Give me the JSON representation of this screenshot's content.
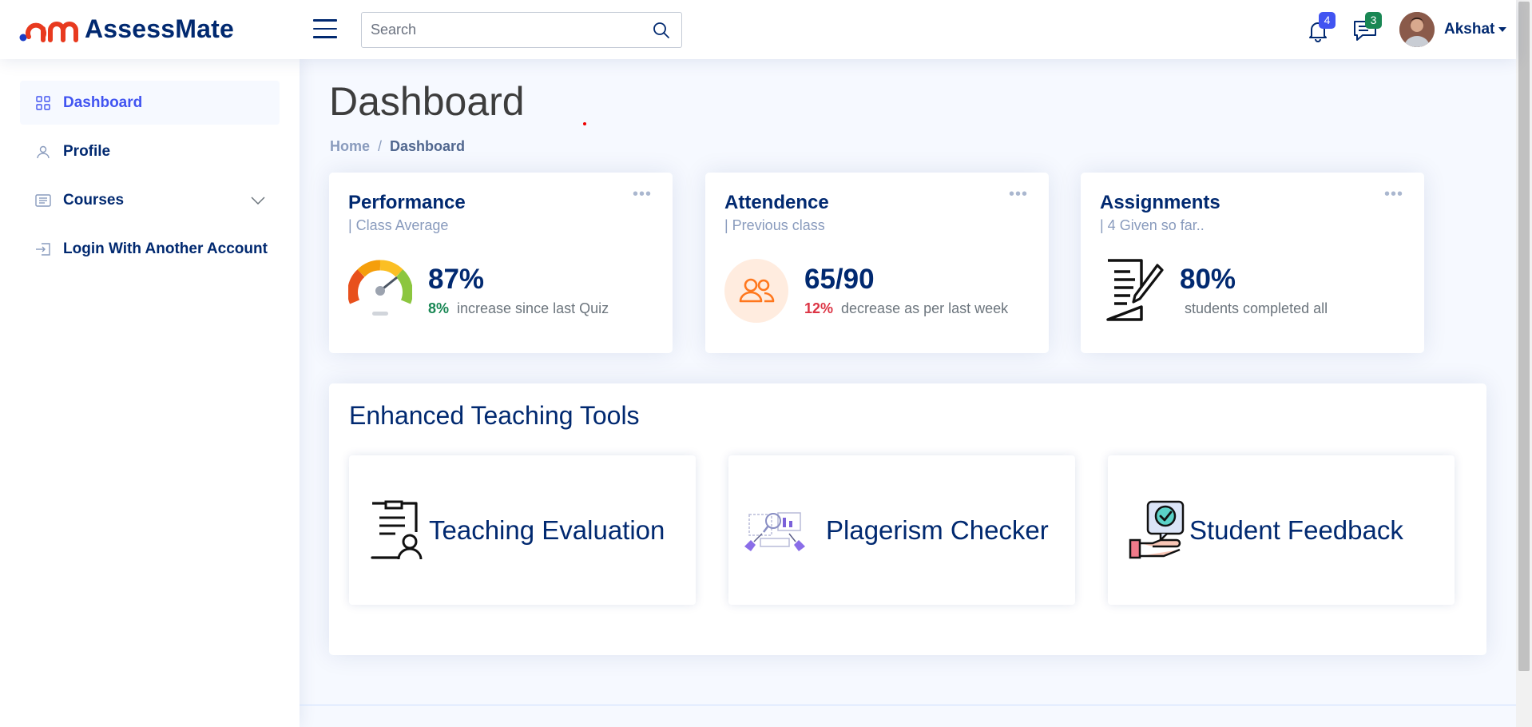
{
  "app": {
    "brand": "AssessMate",
    "brand_colors": {
      "primary": "#012970",
      "accent": "#4154f1",
      "logo_red": "#e83a1f",
      "logo_blue": "#1a3cc6"
    }
  },
  "header": {
    "search_placeholder": "Search",
    "notifications_count": "4",
    "messages_count": "3",
    "user_name": "Akshat"
  },
  "sidebar": {
    "items": [
      {
        "label": "Dashboard",
        "icon": "grid-icon",
        "active": true
      },
      {
        "label": "Profile",
        "icon": "person-icon"
      },
      {
        "label": "Courses",
        "icon": "courses-icon",
        "has_submenu": true
      },
      {
        "label": "Login With Another Account",
        "icon": "login-icon"
      }
    ]
  },
  "page": {
    "title": "Dashboard",
    "breadcrumb": {
      "home": "Home",
      "separator": "/",
      "current": "Dashboard"
    }
  },
  "cards": {
    "performance": {
      "title": "Performance",
      "subtitle": "| Class Average",
      "value": "87%",
      "change": "8%",
      "change_text": "increase since last Quiz",
      "icon": "speedometer-icon"
    },
    "attendance": {
      "title": "Attendence",
      "subtitle": "| Previous class",
      "value": "65/90",
      "change": "12%",
      "change_text": "decrease as per last week",
      "icon": "people-icon"
    },
    "assignments": {
      "title": "Assignments",
      "subtitle": "| 4 Given so far..",
      "value": "80%",
      "change_text": "students completed all",
      "icon": "document-pen-icon"
    }
  },
  "tools": {
    "title": "Enhanced Teaching Tools",
    "items": [
      {
        "label": "Teaching Evaluation",
        "icon": "evaluation-clipboard-icon"
      },
      {
        "label": "Plagerism Checker",
        "icon": "plagiarism-icon"
      },
      {
        "label": "Student Feedback",
        "icon": "feedback-hand-icon"
      }
    ]
  }
}
